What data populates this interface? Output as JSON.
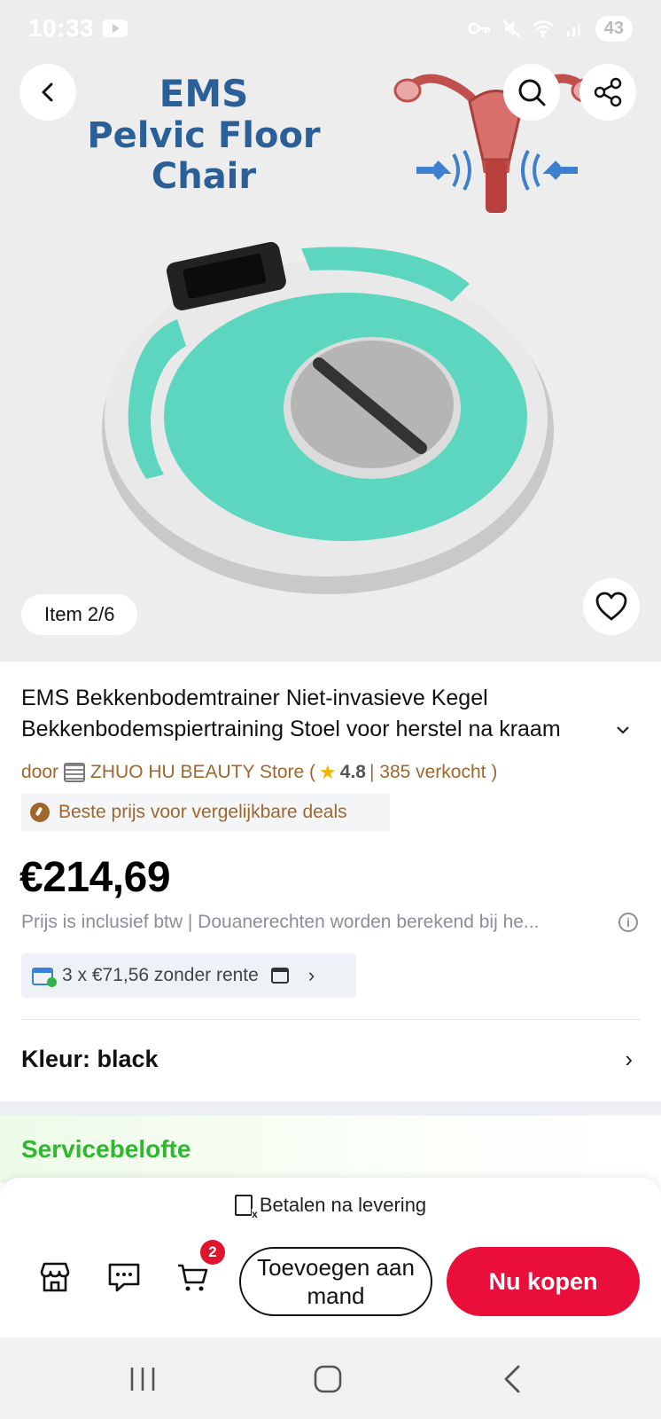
{
  "status_bar": {
    "time": "10:33",
    "battery": "43"
  },
  "hero": {
    "title_line1": "EMS",
    "title_line2": "Pelvic Floor Chair",
    "item_counter": "Item 2/6"
  },
  "product": {
    "title_line1": "EMS Bekkenbodemtrainer Niet-invasieve Kegel",
    "title_line2": "Bekkenbodemspiertraining Stoel voor herstel na kraam",
    "store_prefix": "door",
    "store_name": "ZHUO HU BEAUTY Store (",
    "rating": "4.8",
    "sold": "| 385 verkocht )",
    "deal_badge": "Beste prijs voor vergelijkbare deals",
    "price": "€214,69",
    "tax_note": "Prijs is inclusief btw | Douanerechten worden berekend bij he...",
    "installments": "3 x €71,56 zonder rente",
    "color_label": "Kleur: black"
  },
  "service": {
    "title": "Servicebelofte"
  },
  "bottom": {
    "pay_after": "Betalen na levering",
    "cart_count": "2",
    "add_to_cart": "Toevoegen aan mand",
    "buy_now": "Nu kopen"
  },
  "colors": {
    "accent_red": "#ea0f3b",
    "store_brown": "#a0672d",
    "service_green": "#2eb82e",
    "device_teal": "#5dd6bf"
  }
}
